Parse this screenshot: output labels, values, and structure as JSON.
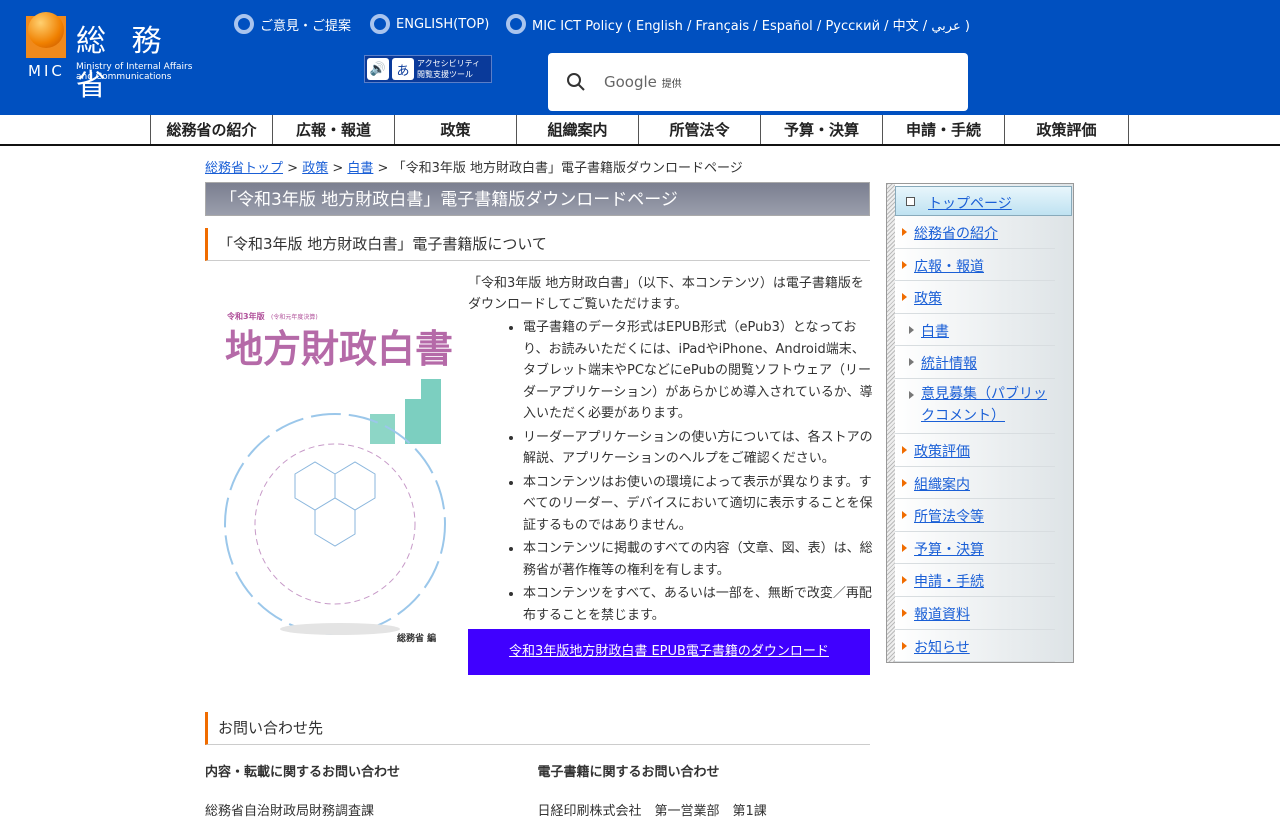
{
  "header": {
    "logo_kanji": "総 務 省",
    "logo_mic": "MIC",
    "logo_en1": "Ministry of Internal Affairs",
    "logo_en2": "and Communications",
    "links": [
      "ご意見・ご提案",
      "ENGLISH(TOP)",
      "MIC ICT Policy ( English / Français / Español / Русский / 中文 / عربي )"
    ],
    "accessibility_l1": "アクセシビリティ",
    "accessibility_l2": "閲覧支援ツール",
    "search_brand": "Google",
    "search_suffix": "提供"
  },
  "nav": [
    "総務省の紹介",
    "広報・報道",
    "政策",
    "組織案内",
    "所管法令",
    "予算・決算",
    "申請・手続",
    "政策評価"
  ],
  "breadcrumb": {
    "items": [
      "総務省トップ",
      "政策",
      "白書"
    ],
    "current": "「令和3年版 地方財政白書」電子書籍版ダウンロードページ",
    "sep": " > "
  },
  "main": {
    "title": "「令和3年版 地方財政白書」電子書籍版ダウンロードページ",
    "section1": "「令和3年版 地方財政白書」電子書籍版について",
    "cover": {
      "edition": "令和3年版",
      "sub": "(令和元年度決算)",
      "title": "地方財政白書",
      "publisher": "総務省 編"
    },
    "intro": "「令和3年版 地方財政白書」（以下、本コンテンツ）は電子書籍版をダウンロードしてご覧いただけます。",
    "bullets": [
      "電子書籍のデータ形式はEPUB形式（ePub3）となっており、お読みいただくには、iPadやiPhone、Android端末、タブレット端末やPCなどにePubの閲覧ソフトウェア（リーダーアプリケーション）があらかじめ導入されているか、導入いただく必要があります。",
      "リーダーアプリケーションの使い方については、各ストアの解説、アプリケーションのヘルプをご確認ください。",
      "本コンテンツはお使いの環境によって表示が異なります。すべてのリーダー、デバイスにおいて適切に表示することを保証するものではありません。",
      "本コンテンツに掲載のすべての内容（文章、図、表）は、総務省が著作権等の権利を有します。",
      "本コンテンツをすべて、あるいは一部を、無断で改変／再配布することを禁じます。"
    ],
    "download": "令和3年版地方財政白書 EPUB電子書籍のダウンロード",
    "contact_title": "お問い合わせ先",
    "contact": [
      {
        "head": "内容・転載に関するお問い合わせ",
        "body": "総務省自治財政局財務調査課"
      },
      {
        "head": "電子書籍に関するお問い合わせ",
        "body": "日経印刷株式会社　第一営業部　第1課"
      }
    ]
  },
  "sidebar": {
    "top": "トップページ",
    "items": [
      "総務省の紹介",
      "広報・報道",
      "政策",
      "白書",
      "統計情報",
      "意見募集（パブリックコメント）",
      "政策評価",
      "組織案内",
      "所管法令等",
      "予算・決算",
      "申請・手続",
      "報道資料",
      "お知らせ"
    ]
  }
}
